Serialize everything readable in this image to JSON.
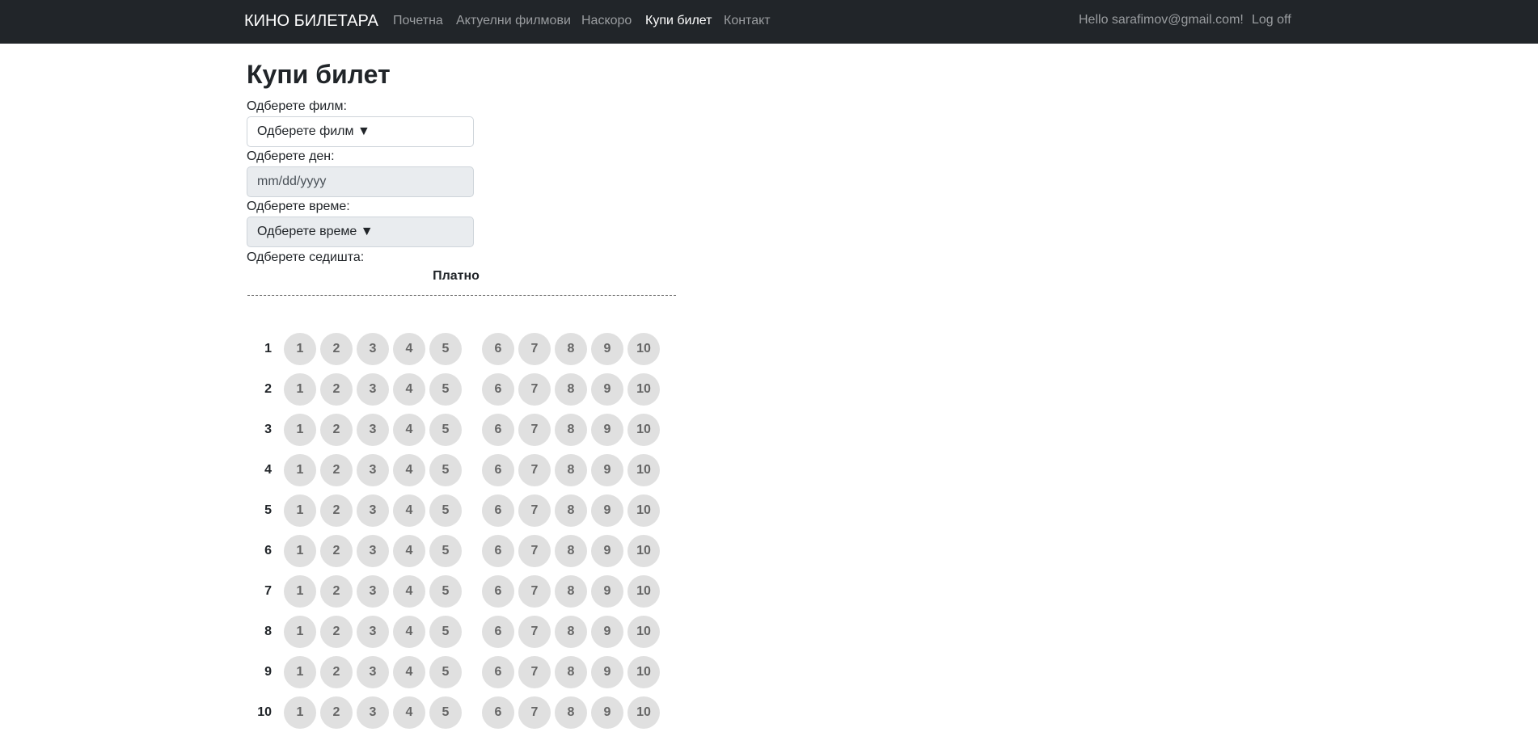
{
  "navbar": {
    "brand": "КИНО БИЛЕТАРА",
    "links": [
      "Почетна",
      "Актуелни филмови",
      "Наскоро",
      "Купи билет",
      "Контакт"
    ],
    "user_greeting": "Hello sarafimov@gmail.com!",
    "logoff": "Log off"
  },
  "page": {
    "title": "Купи билет"
  },
  "form": {
    "movie_label": "Одберете филм:",
    "movie_placeholder": "Одберете филм",
    "day_label": "Одберете ден:",
    "day_placeholder": "mm/dd/yyyy",
    "time_label": "Одберете време:",
    "time_placeholder": "Одберете време",
    "dropdown_arrow": "▼",
    "seats_label": "Одберете седишта:"
  },
  "seating": {
    "screen_label": "Платно",
    "rows": [
      "1",
      "2",
      "3",
      "4",
      "5",
      "6",
      "7",
      "8",
      "9",
      "10"
    ],
    "seats": [
      "1",
      "2",
      "3",
      "4",
      "5",
      "6",
      "7",
      "8",
      "9",
      "10"
    ],
    "seat_color": "#e0e0e0",
    "seat_text_color": "#666666"
  }
}
